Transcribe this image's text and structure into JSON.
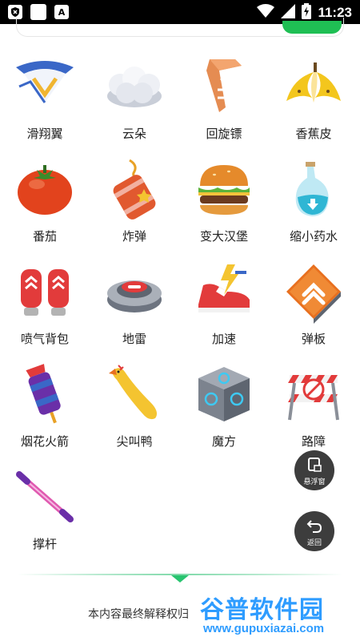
{
  "status_bar": {
    "time": "11:23",
    "left_icons": [
      "shield-x-icon",
      "blank-square-icon",
      "font-a-icon"
    ],
    "right_icons": [
      "wifi-icon",
      "signal-icon",
      "battery-charging-icon"
    ]
  },
  "colors": {
    "accent_green": "#1fbf54",
    "fab_bg": "#3d3d3d",
    "watermark_blue": "#2e9cff"
  },
  "items": [
    {
      "label": "滑翔翼",
      "icon": "glider-icon"
    },
    {
      "label": "云朵",
      "icon": "cloud-icon"
    },
    {
      "label": "回旋镖",
      "icon": "boomerang-icon"
    },
    {
      "label": "香蕉皮",
      "icon": "banana-peel-icon"
    },
    {
      "label": "番茄",
      "icon": "tomato-icon"
    },
    {
      "label": "炸弹",
      "icon": "dynamite-bomb-icon"
    },
    {
      "label": "变大汉堡",
      "icon": "burger-icon"
    },
    {
      "label": "缩小药水",
      "icon": "potion-icon"
    },
    {
      "label": "喷气背包",
      "icon": "jetpack-icon"
    },
    {
      "label": "地雷",
      "icon": "landmine-icon"
    },
    {
      "label": "加速",
      "icon": "speed-shoe-icon"
    },
    {
      "label": "弹板",
      "icon": "spring-board-icon"
    },
    {
      "label": "烟花火箭",
      "icon": "firework-rocket-icon"
    },
    {
      "label": "尖叫鸭",
      "icon": "screaming-duck-icon"
    },
    {
      "label": "魔方",
      "icon": "magic-cube-icon"
    },
    {
      "label": "路障",
      "icon": "roadblock-icon"
    },
    {
      "label": "撑杆",
      "icon": "pole-icon"
    }
  ],
  "fab": {
    "float_label": "悬浮窗",
    "back_label": "返回"
  },
  "footer": {
    "text": "本内容最终解释权归"
  },
  "watermark": {
    "main": "谷普软件园",
    "sub": "www.gupuxiazai.com"
  }
}
